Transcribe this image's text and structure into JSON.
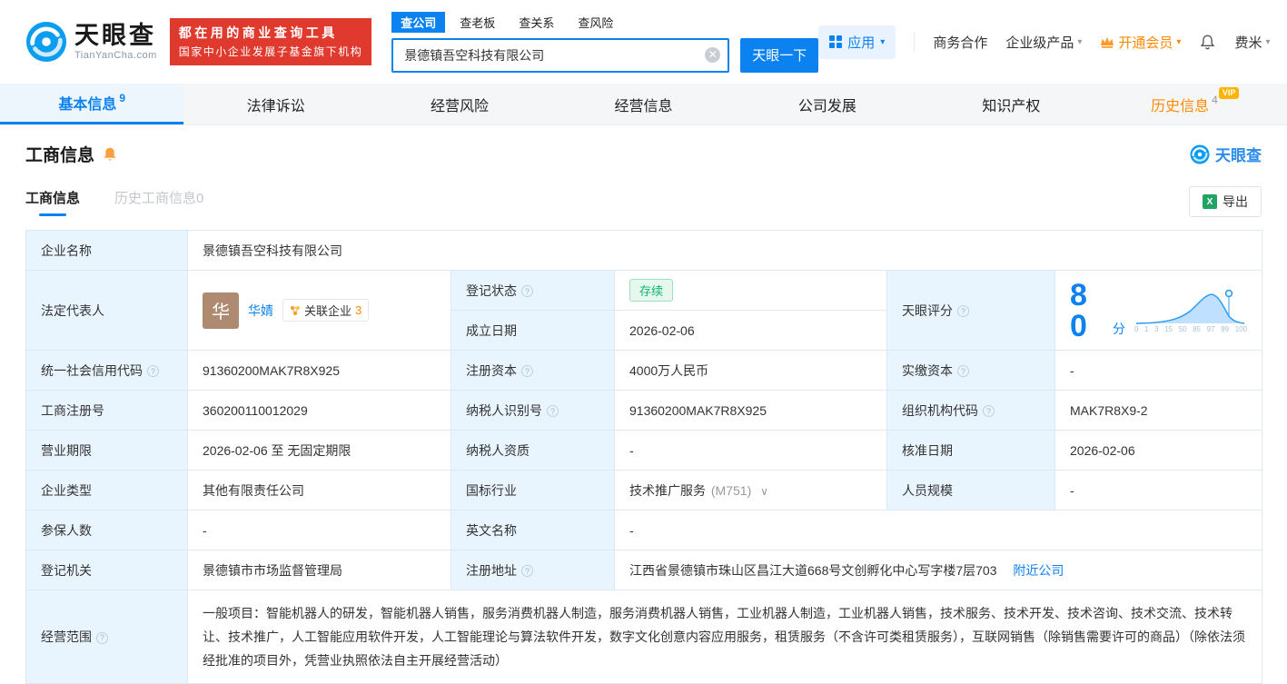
{
  "colors": {
    "brand_blue": "#0b82f0",
    "banner_red": "#e0392e",
    "vip_orange": "#ff8a00",
    "status_green": "#0eb56f",
    "label_cell_bg": "#e9f5fe"
  },
  "header": {
    "logo": {
      "cn": "天眼查",
      "en": "TianYanCha.com"
    },
    "banner": {
      "line1": "都在用的商业查询工具",
      "line2": "国家中小企业发展子基金旗下机构"
    },
    "search_tabs": [
      "查公司",
      "查老板",
      "查关系",
      "查风险"
    ],
    "search": {
      "value": "景德镇吾空科技有限公司",
      "button": "天眼一下"
    },
    "menu": {
      "apps": "应用",
      "cooperation": "商务合作",
      "products": "企业级产品",
      "vip": "开通会员",
      "user": "费米"
    }
  },
  "nav": {
    "tabs": [
      {
        "label": "基本信息",
        "count": "9"
      },
      {
        "label": "法律诉讼"
      },
      {
        "label": "经营风险"
      },
      {
        "label": "经营信息"
      },
      {
        "label": "公司发展"
      },
      {
        "label": "知识产权"
      },
      {
        "label": "历史信息",
        "count": "4",
        "badge": "VIP"
      }
    ]
  },
  "section": {
    "title": "工商信息",
    "brand": "天眼查",
    "subtab_active": "工商信息",
    "subtab_history": "历史工商信息0",
    "export": "导出"
  },
  "fields": {
    "name": {
      "label": "企业名称",
      "value": "景德镇吾空科技有限公司"
    },
    "legal_rep": {
      "label": "法定代表人",
      "avatar": "华",
      "name": "华婧",
      "tag": "关联企业",
      "tag_count": "3"
    },
    "reg_status": {
      "label": "登记状态",
      "value": "存续"
    },
    "establish_date": {
      "label": "成立日期",
      "value": "2026-02-06"
    },
    "score": {
      "label": "天眼评分",
      "value": "80",
      "unit": "分",
      "axis": [
        "0",
        "1",
        "3",
        "15",
        "50",
        "85",
        "97",
        "99",
        "100"
      ]
    },
    "credit_code": {
      "label": "统一社会信用代码",
      "value": "91360200MAK7R8X925"
    },
    "reg_capital": {
      "label": "注册资本",
      "value": "4000万人民币"
    },
    "paid_capital": {
      "label": "实缴资本",
      "value": "-"
    },
    "reg_number": {
      "label": "工商注册号",
      "value": "360200110012029"
    },
    "taxpayer_id": {
      "label": "纳税人识别号",
      "value": "91360200MAK7R8X925"
    },
    "org_code": {
      "label": "组织机构代码",
      "value": "MAK7R8X9-2"
    },
    "business_term": {
      "label": "营业期限",
      "value": "2026-02-06 至 无固定期限"
    },
    "taxpayer_quality": {
      "label": "纳税人资质",
      "value": "-"
    },
    "approval_date": {
      "label": "核准日期",
      "value": "2026-02-06"
    },
    "company_type": {
      "label": "企业类型",
      "value": "其他有限责任公司"
    },
    "industry": {
      "label": "国标行业",
      "value": "技术推广服务",
      "code": "(M751)"
    },
    "staff_size": {
      "label": "人员规模",
      "value": "-"
    },
    "insured_count": {
      "label": "参保人数",
      "value": "-"
    },
    "english_name": {
      "label": "英文名称",
      "value": "-"
    },
    "reg_authority": {
      "label": "登记机关",
      "value": "景德镇市市场监督管理局"
    },
    "address": {
      "label": "注册地址",
      "value": "江西省景德镇市珠山区昌江大道668号文创孵化中心写字楼7层703",
      "nearby": "附近公司"
    },
    "business_scope": {
      "label": "经营范围",
      "value": "一般项目：智能机器人的研发，智能机器人销售，服务消费机器人制造，服务消费机器人销售，工业机器人制造，工业机器人销售，技术服务、技术开发、技术咨询、技术交流、技术转让、技术推广，人工智能应用软件开发，人工智能理论与算法软件开发，数字文化创意内容应用服务，租赁服务（不含许可类租赁服务），互联网销售（除销售需要许可的商品）（除依法须经批准的项目外，凭营业执照依法自主开展经营活动）"
    }
  }
}
